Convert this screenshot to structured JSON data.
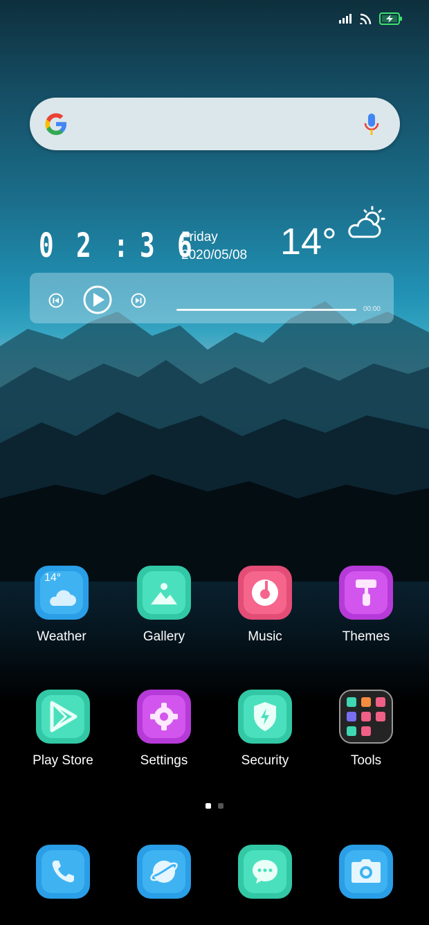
{
  "clock": {
    "d1": "0",
    "d2": "2",
    "sep": ":",
    "d3": "3",
    "d4": "6",
    "day": "Friday",
    "date": "2020/05/08",
    "temp": "14°"
  },
  "player": {
    "time": "00:00",
    "progress": 0
  },
  "apps": [
    {
      "label": "Weather",
      "icon": "weather-icon",
      "badge": "14°"
    },
    {
      "label": "Gallery",
      "icon": "gallery-icon"
    },
    {
      "label": "Music",
      "icon": "music-icon"
    },
    {
      "label": "Themes",
      "icon": "themes-icon"
    },
    {
      "label": "Play Store",
      "icon": "play-store-icon"
    },
    {
      "label": "Settings",
      "icon": "settings-icon"
    },
    {
      "label": "Security",
      "icon": "security-icon"
    },
    {
      "label": "Tools",
      "icon": "tools-folder-icon"
    }
  ],
  "dock": [
    {
      "icon": "phone-icon"
    },
    {
      "icon": "browser-icon"
    },
    {
      "icon": "messages-icon"
    },
    {
      "icon": "camera-icon"
    }
  ],
  "pages": {
    "count": 2,
    "current": 1
  },
  "colors": {
    "blue": "#27a7e8",
    "teal": "#3fd7b3",
    "pink": "#ef5f86",
    "purple": "#c545e6"
  }
}
